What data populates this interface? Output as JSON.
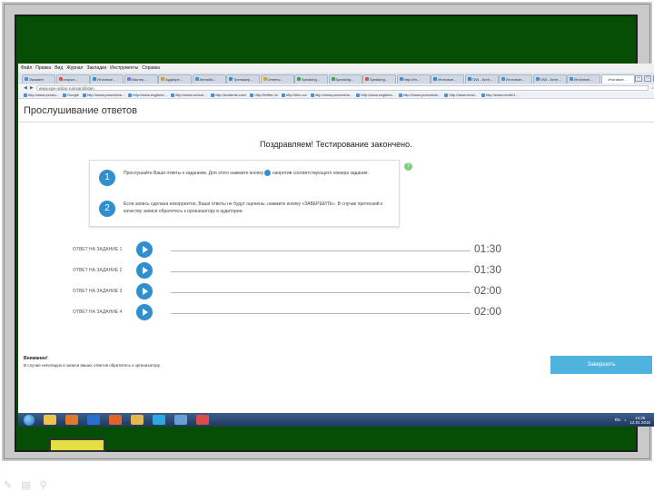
{
  "menubar": {
    "items": [
      "Файл",
      "Правка",
      "Вид",
      "Журнал",
      "Закладки",
      "Инструменты",
      "Справка"
    ]
  },
  "browser": {
    "tabs": [
      {
        "label": "Экзамен",
        "color": "#4a8fd6"
      },
      {
        "label": "открыт...",
        "color": "#d9544d"
      },
      {
        "label": "Итоговое...",
        "color": "#2f8fcf"
      },
      {
        "label": "Мастер...",
        "color": "#8f6fcf"
      },
      {
        "label": "Аудиоре...",
        "color": "#d79b2a"
      },
      {
        "label": "Английс...",
        "color": "#4a8fd6"
      },
      {
        "label": "Тренажер...",
        "color": "#2f8fcf"
      },
      {
        "label": "Ответы...",
        "color": "#e0a020"
      },
      {
        "label": "Speaking...",
        "color": "#3fa34d"
      },
      {
        "label": "Speaking...",
        "color": "#3fa34d"
      },
      {
        "label": "Speaking...",
        "color": "#d9544d"
      },
      {
        "label": "http://en...",
        "color": "#4a8fd6"
      },
      {
        "label": "Итоговое...",
        "color": "#2f8fcf"
      },
      {
        "label": "ГИА - Англ...",
        "color": "#2f8fcf"
      },
      {
        "label": "Итоговое...",
        "color": "#4a8fd6"
      },
      {
        "label": "ГИА - Англ...",
        "color": "#4a8fd6"
      },
      {
        "label": "Итоговое...",
        "color": "#4a8fd6"
      },
      {
        "label": "Итоговое...",
        "color": "#ffffff"
      }
    ],
    "url": "www.ege-online.ru/exam/listen",
    "bookmarks": [
      "http://www.prosto...",
      "Google",
      "http://www.prosveshe...",
      "http://www.englishe...",
      "http://www.school...",
      "http://students.com/",
      "http://lefthe.ru/",
      "http://bbc.co/",
      "http://www.prosveshe...",
      "http://www.englishe...",
      "http://www.prosveshe...",
      "http://www.mesl...",
      "http://www.centrh1..."
    ]
  },
  "page": {
    "title": "Прослушивание ответов",
    "congrats": "Поздравляем! Тестирование закончено.",
    "steps": [
      {
        "num": "1",
        "text_before": "Прослушайте Ваши ответы к заданиям. Для этого нажмите кнопку",
        "text_after": "напротив соответствующего номера задания."
      },
      {
        "num": "2",
        "text": "Если запись сделана некорректно, Ваши ответы не будут оценены, нажмите кнопку «ЗАВЕРШИТЬ». В случае претензий к качеству записи обратитесь к организатору в аудитории."
      }
    ],
    "answers": [
      {
        "label": "ОТВЕТ НА ЗАДАНИЕ 1",
        "time": "01:30"
      },
      {
        "label": "ОТВЕТ НА ЗАДАНИЕ 2",
        "time": "01:30"
      },
      {
        "label": "ОТВЕТ НА ЗАДАНИЕ 3",
        "time": "02:00"
      },
      {
        "label": "ОТВЕТ НА ЗАДАНИЕ 4",
        "time": "02:00"
      }
    ],
    "warning_title": "Внимание!",
    "warning_text": "В случае неполадок в записи ваших ответов обратитесь к организатору.",
    "finish_label": "Завершить"
  },
  "taskbar": {
    "lang": "RU",
    "time": "14:25",
    "date": "12.01.2015",
    "icons": [
      {
        "name": "explorer-icon",
        "color": "#f0c34a"
      },
      {
        "name": "media-icon",
        "color": "#e07a2a"
      },
      {
        "name": "winword-icon",
        "color": "#2a6fc9"
      },
      {
        "name": "firefox-icon",
        "color": "#e0642a"
      },
      {
        "name": "folder-icon",
        "color": "#e8b64a"
      },
      {
        "name": "skype-icon",
        "color": "#2fa8e0"
      },
      {
        "name": "audio-icon",
        "color": "#6a9fd6"
      },
      {
        "name": "paint-icon",
        "color": "#d94d4d"
      }
    ]
  },
  "colors": {
    "accent": "#2f8fcf",
    "finish_button": "#4fb3dd",
    "board": "#064e06"
  }
}
